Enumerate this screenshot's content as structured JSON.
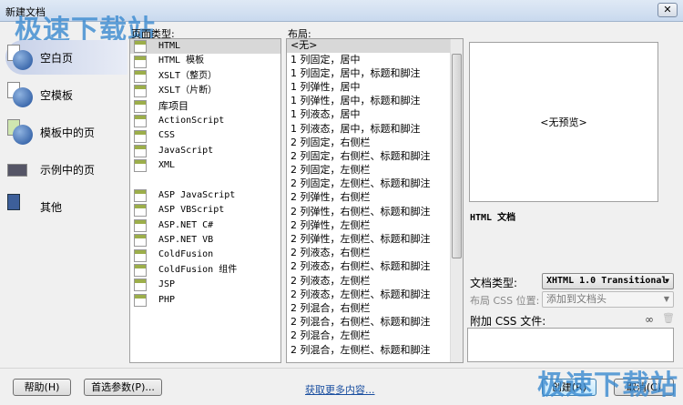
{
  "window": {
    "title": "新建文档",
    "close": "✕"
  },
  "watermark": "极速下载站",
  "categories": [
    {
      "label": "空白页"
    },
    {
      "label": "空模板"
    },
    {
      "label": "模板中的页"
    },
    {
      "label": "示例中的页"
    },
    {
      "label": "其他"
    }
  ],
  "page_type": {
    "label": "页面类型:",
    "items": [
      "HTML",
      "HTML 模板",
      "XSLT（整页）",
      "XSLT（片断）",
      "库项目",
      "ActionScript",
      "CSS",
      "JavaScript",
      "XML",
      "",
      "ASP JavaScript",
      "ASP VBScript",
      "ASP.NET C#",
      "ASP.NET VB",
      "ColdFusion",
      "ColdFusion 组件",
      "JSP",
      "PHP"
    ]
  },
  "layout": {
    "label": "布局:",
    "items": [
      "<无>",
      "1 列固定，居中",
      "1 列固定，居中，标题和脚注",
      "1 列弹性，居中",
      "1 列弹性，居中，标题和脚注",
      "1 列液态，居中",
      "1 列液态，居中，标题和脚注",
      "2 列固定，右侧栏",
      "2 列固定，右侧栏、标题和脚注",
      "2 列固定，左侧栏",
      "2 列固定，左侧栏、标题和脚注",
      "2 列弹性，右侧栏",
      "2 列弹性，右侧栏、标题和脚注",
      "2 列弹性，左侧栏",
      "2 列弹性，左侧栏、标题和脚注",
      "2 列液态，右侧栏",
      "2 列液态，右侧栏、标题和脚注",
      "2 列液态，左侧栏",
      "2 列液态，左侧栏、标题和脚注",
      "2 列混合，右侧栏",
      "2 列混合，右侧栏、标题和脚注",
      "2 列混合，左侧栏",
      "2 列混合，左侧栏、标题和脚注"
    ]
  },
  "preview": {
    "text": "<无预览>",
    "description": "HTML 文档"
  },
  "doctype": {
    "label": "文档类型:",
    "value": "XHTML 1.0 Transitional"
  },
  "css_position": {
    "label": "布局 CSS 位置:",
    "value": "添加到文档头"
  },
  "attach_css": {
    "label": "附加 CSS 文件:"
  },
  "buttons": {
    "help": "帮助(H)",
    "prefs": "首选参数(P)...",
    "more": "获取更多内容...",
    "create": "创建(R)",
    "cancel": "取消(C)"
  }
}
